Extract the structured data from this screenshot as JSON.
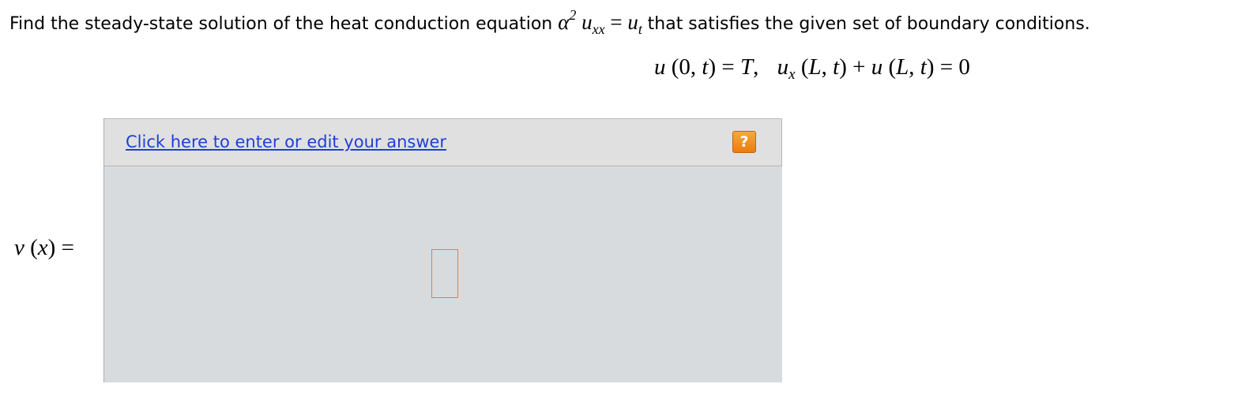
{
  "question": {
    "prefix": "Find the steady-state solution of the heat conduction equation ",
    "suffix": " that satisfies the given set of boundary conditions.",
    "equation": {
      "alpha": "α",
      "alpha_power": "2",
      "u_main": "u",
      "u_subscript": "xx",
      "equals": "=",
      "rhs_main": "u",
      "rhs_subscript": "t"
    }
  },
  "boundary": {
    "part1": "u",
    "part2": "(0, ",
    "part3": "t",
    "part4": ") = ",
    "part5": "T",
    "part6": ",",
    "part7": "u",
    "part8": "x",
    "part9": "(",
    "part10": "L",
    "part11": ", ",
    "part12": "t",
    "part13": ") + ",
    "part14": "u",
    "part15": "(",
    "part16": "L",
    "part17": ", ",
    "part18": "t",
    "part19": ") = 0"
  },
  "answer": {
    "lhs_v": "v",
    "lhs_open": "(",
    "lhs_x": "x",
    "lhs_close_equals": ") =",
    "edit_link": "Click here to enter or edit your answer",
    "help_label": "?"
  }
}
